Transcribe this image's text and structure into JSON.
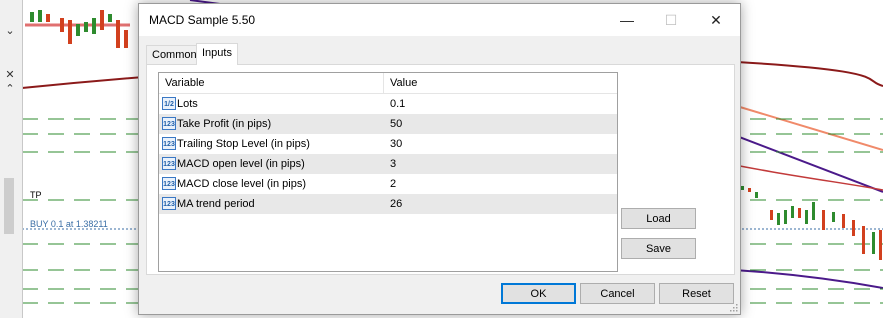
{
  "colors": {
    "dialog_bg": "#f0f0f0",
    "accent": "#0078d7",
    "bull_candle": "#2e8b2e",
    "bear_candle": "#d2401e",
    "ma_dark_red": "#8b1a1a",
    "ma_salmon": "#f08a6a",
    "ma_purple": "#4b1a8a",
    "level_green": "#2e8b2e"
  },
  "chart": {
    "tp_label": "TP",
    "order_label": "BUY 0.1 at 1.38211",
    "strip_icons": [
      "chevron-down-icon",
      "close-icon",
      "chevron-up-icon"
    ]
  },
  "dialog": {
    "title": "MACD Sample 5.50",
    "minimize": "—",
    "maximize": "☐",
    "close": "✕",
    "tabs": [
      {
        "label": "Common",
        "active": false
      },
      {
        "label": "Inputs",
        "active": true
      }
    ],
    "grid": {
      "columns": {
        "variable": "Variable",
        "value": "Value"
      },
      "rows": [
        {
          "icon": "1/2",
          "variable": "Lots",
          "value": "0.1"
        },
        {
          "icon": "123",
          "variable": "Take Profit (in pips)",
          "value": "50"
        },
        {
          "icon": "123",
          "variable": "Trailing Stop Level (in pips)",
          "value": "30"
        },
        {
          "icon": "123",
          "variable": "MACD open level (in pips)",
          "value": "3"
        },
        {
          "icon": "123",
          "variable": "MACD close level (in pips)",
          "value": "2"
        },
        {
          "icon": "123",
          "variable": "MA trend period",
          "value": "26"
        }
      ]
    },
    "buttons": {
      "load": "Load",
      "save": "Save",
      "ok": "OK",
      "cancel": "Cancel",
      "reset": "Reset"
    }
  }
}
